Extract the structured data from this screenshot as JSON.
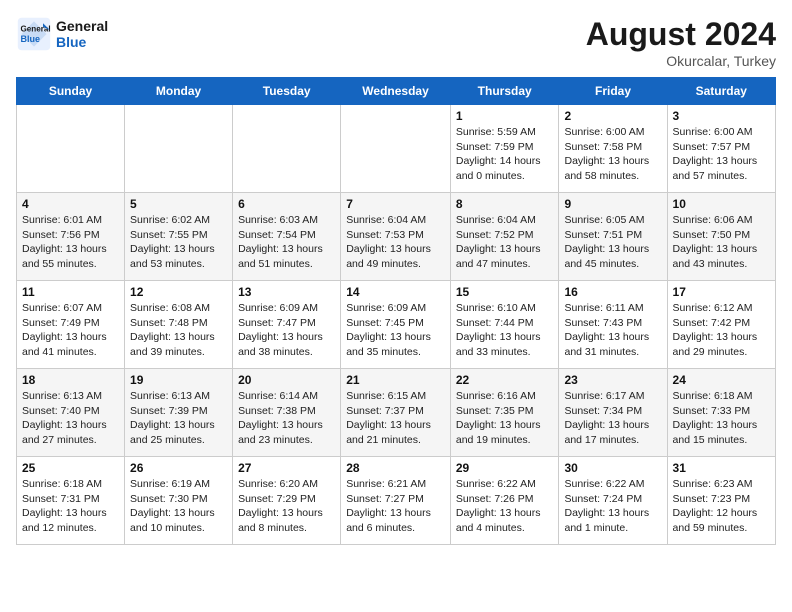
{
  "header": {
    "logo_line1": "General",
    "logo_line2": "Blue",
    "month_year": "August 2024",
    "location": "Okurcalar, Turkey"
  },
  "days_of_week": [
    "Sunday",
    "Monday",
    "Tuesday",
    "Wednesday",
    "Thursday",
    "Friday",
    "Saturday"
  ],
  "weeks": [
    [
      {
        "day": "",
        "info": ""
      },
      {
        "day": "",
        "info": ""
      },
      {
        "day": "",
        "info": ""
      },
      {
        "day": "",
        "info": ""
      },
      {
        "day": "1",
        "info": "Sunrise: 5:59 AM\nSunset: 7:59 PM\nDaylight: 14 hours and 0 minutes."
      },
      {
        "day": "2",
        "info": "Sunrise: 6:00 AM\nSunset: 7:58 PM\nDaylight: 13 hours and 58 minutes."
      },
      {
        "day": "3",
        "info": "Sunrise: 6:00 AM\nSunset: 7:57 PM\nDaylight: 13 hours and 57 minutes."
      }
    ],
    [
      {
        "day": "4",
        "info": "Sunrise: 6:01 AM\nSunset: 7:56 PM\nDaylight: 13 hours and 55 minutes."
      },
      {
        "day": "5",
        "info": "Sunrise: 6:02 AM\nSunset: 7:55 PM\nDaylight: 13 hours and 53 minutes."
      },
      {
        "day": "6",
        "info": "Sunrise: 6:03 AM\nSunset: 7:54 PM\nDaylight: 13 hours and 51 minutes."
      },
      {
        "day": "7",
        "info": "Sunrise: 6:04 AM\nSunset: 7:53 PM\nDaylight: 13 hours and 49 minutes."
      },
      {
        "day": "8",
        "info": "Sunrise: 6:04 AM\nSunset: 7:52 PM\nDaylight: 13 hours and 47 minutes."
      },
      {
        "day": "9",
        "info": "Sunrise: 6:05 AM\nSunset: 7:51 PM\nDaylight: 13 hours and 45 minutes."
      },
      {
        "day": "10",
        "info": "Sunrise: 6:06 AM\nSunset: 7:50 PM\nDaylight: 13 hours and 43 minutes."
      }
    ],
    [
      {
        "day": "11",
        "info": "Sunrise: 6:07 AM\nSunset: 7:49 PM\nDaylight: 13 hours and 41 minutes."
      },
      {
        "day": "12",
        "info": "Sunrise: 6:08 AM\nSunset: 7:48 PM\nDaylight: 13 hours and 39 minutes."
      },
      {
        "day": "13",
        "info": "Sunrise: 6:09 AM\nSunset: 7:47 PM\nDaylight: 13 hours and 38 minutes."
      },
      {
        "day": "14",
        "info": "Sunrise: 6:09 AM\nSunset: 7:45 PM\nDaylight: 13 hours and 35 minutes."
      },
      {
        "day": "15",
        "info": "Sunrise: 6:10 AM\nSunset: 7:44 PM\nDaylight: 13 hours and 33 minutes."
      },
      {
        "day": "16",
        "info": "Sunrise: 6:11 AM\nSunset: 7:43 PM\nDaylight: 13 hours and 31 minutes."
      },
      {
        "day": "17",
        "info": "Sunrise: 6:12 AM\nSunset: 7:42 PM\nDaylight: 13 hours and 29 minutes."
      }
    ],
    [
      {
        "day": "18",
        "info": "Sunrise: 6:13 AM\nSunset: 7:40 PM\nDaylight: 13 hours and 27 minutes."
      },
      {
        "day": "19",
        "info": "Sunrise: 6:13 AM\nSunset: 7:39 PM\nDaylight: 13 hours and 25 minutes."
      },
      {
        "day": "20",
        "info": "Sunrise: 6:14 AM\nSunset: 7:38 PM\nDaylight: 13 hours and 23 minutes."
      },
      {
        "day": "21",
        "info": "Sunrise: 6:15 AM\nSunset: 7:37 PM\nDaylight: 13 hours and 21 minutes."
      },
      {
        "day": "22",
        "info": "Sunrise: 6:16 AM\nSunset: 7:35 PM\nDaylight: 13 hours and 19 minutes."
      },
      {
        "day": "23",
        "info": "Sunrise: 6:17 AM\nSunset: 7:34 PM\nDaylight: 13 hours and 17 minutes."
      },
      {
        "day": "24",
        "info": "Sunrise: 6:18 AM\nSunset: 7:33 PM\nDaylight: 13 hours and 15 minutes."
      }
    ],
    [
      {
        "day": "25",
        "info": "Sunrise: 6:18 AM\nSunset: 7:31 PM\nDaylight: 13 hours and 12 minutes."
      },
      {
        "day": "26",
        "info": "Sunrise: 6:19 AM\nSunset: 7:30 PM\nDaylight: 13 hours and 10 minutes."
      },
      {
        "day": "27",
        "info": "Sunrise: 6:20 AM\nSunset: 7:29 PM\nDaylight: 13 hours and 8 minutes."
      },
      {
        "day": "28",
        "info": "Sunrise: 6:21 AM\nSunset: 7:27 PM\nDaylight: 13 hours and 6 minutes."
      },
      {
        "day": "29",
        "info": "Sunrise: 6:22 AM\nSunset: 7:26 PM\nDaylight: 13 hours and 4 minutes."
      },
      {
        "day": "30",
        "info": "Sunrise: 6:22 AM\nSunset: 7:24 PM\nDaylight: 13 hours and 1 minute."
      },
      {
        "day": "31",
        "info": "Sunrise: 6:23 AM\nSunset: 7:23 PM\nDaylight: 12 hours and 59 minutes."
      }
    ]
  ]
}
